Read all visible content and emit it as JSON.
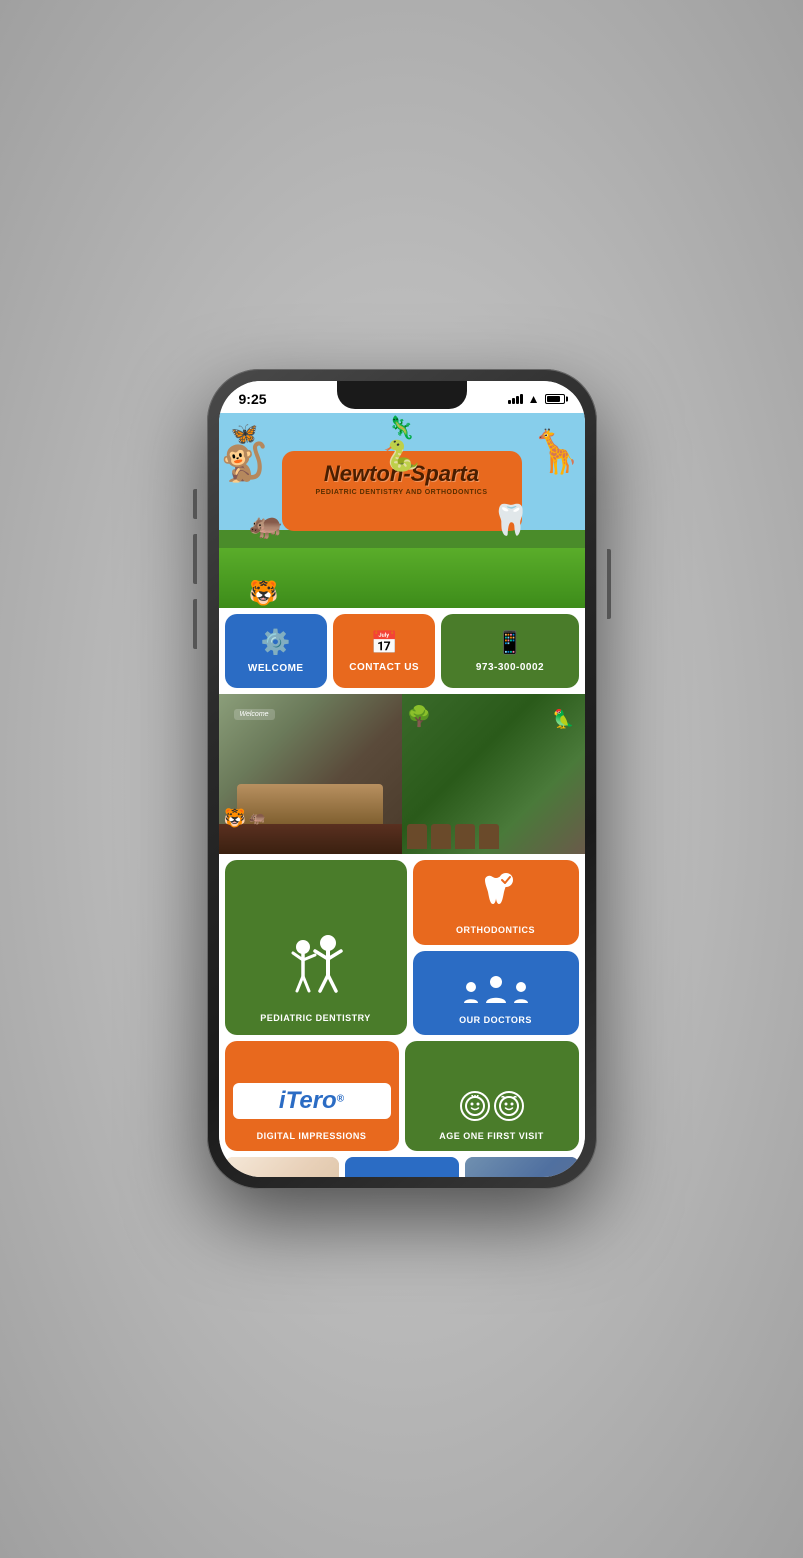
{
  "statusBar": {
    "time": "9:25"
  },
  "banner": {
    "title": "Newton-Sparta",
    "subtitle": "PEDIATRIC DENTISTRY AND ORTHODONTICS"
  },
  "buttons": {
    "welcome_label": "WELCOME",
    "contact_label": "CONTACT US",
    "phone_number": "973-300-0002"
  },
  "services": {
    "pediatric_label": "PEDIATRIC DENTISTRY",
    "orthodontics_label": "ORTHODONTICS",
    "doctors_label": "OUR DOCTORS",
    "itero_brand": "iTero",
    "itero_reg": "®",
    "itero_label": "DIGITAL IMPRESSIONS",
    "age_one_label": "AGE ONE FIRST VISIT"
  },
  "footer": {
    "flag_button": "flag"
  }
}
